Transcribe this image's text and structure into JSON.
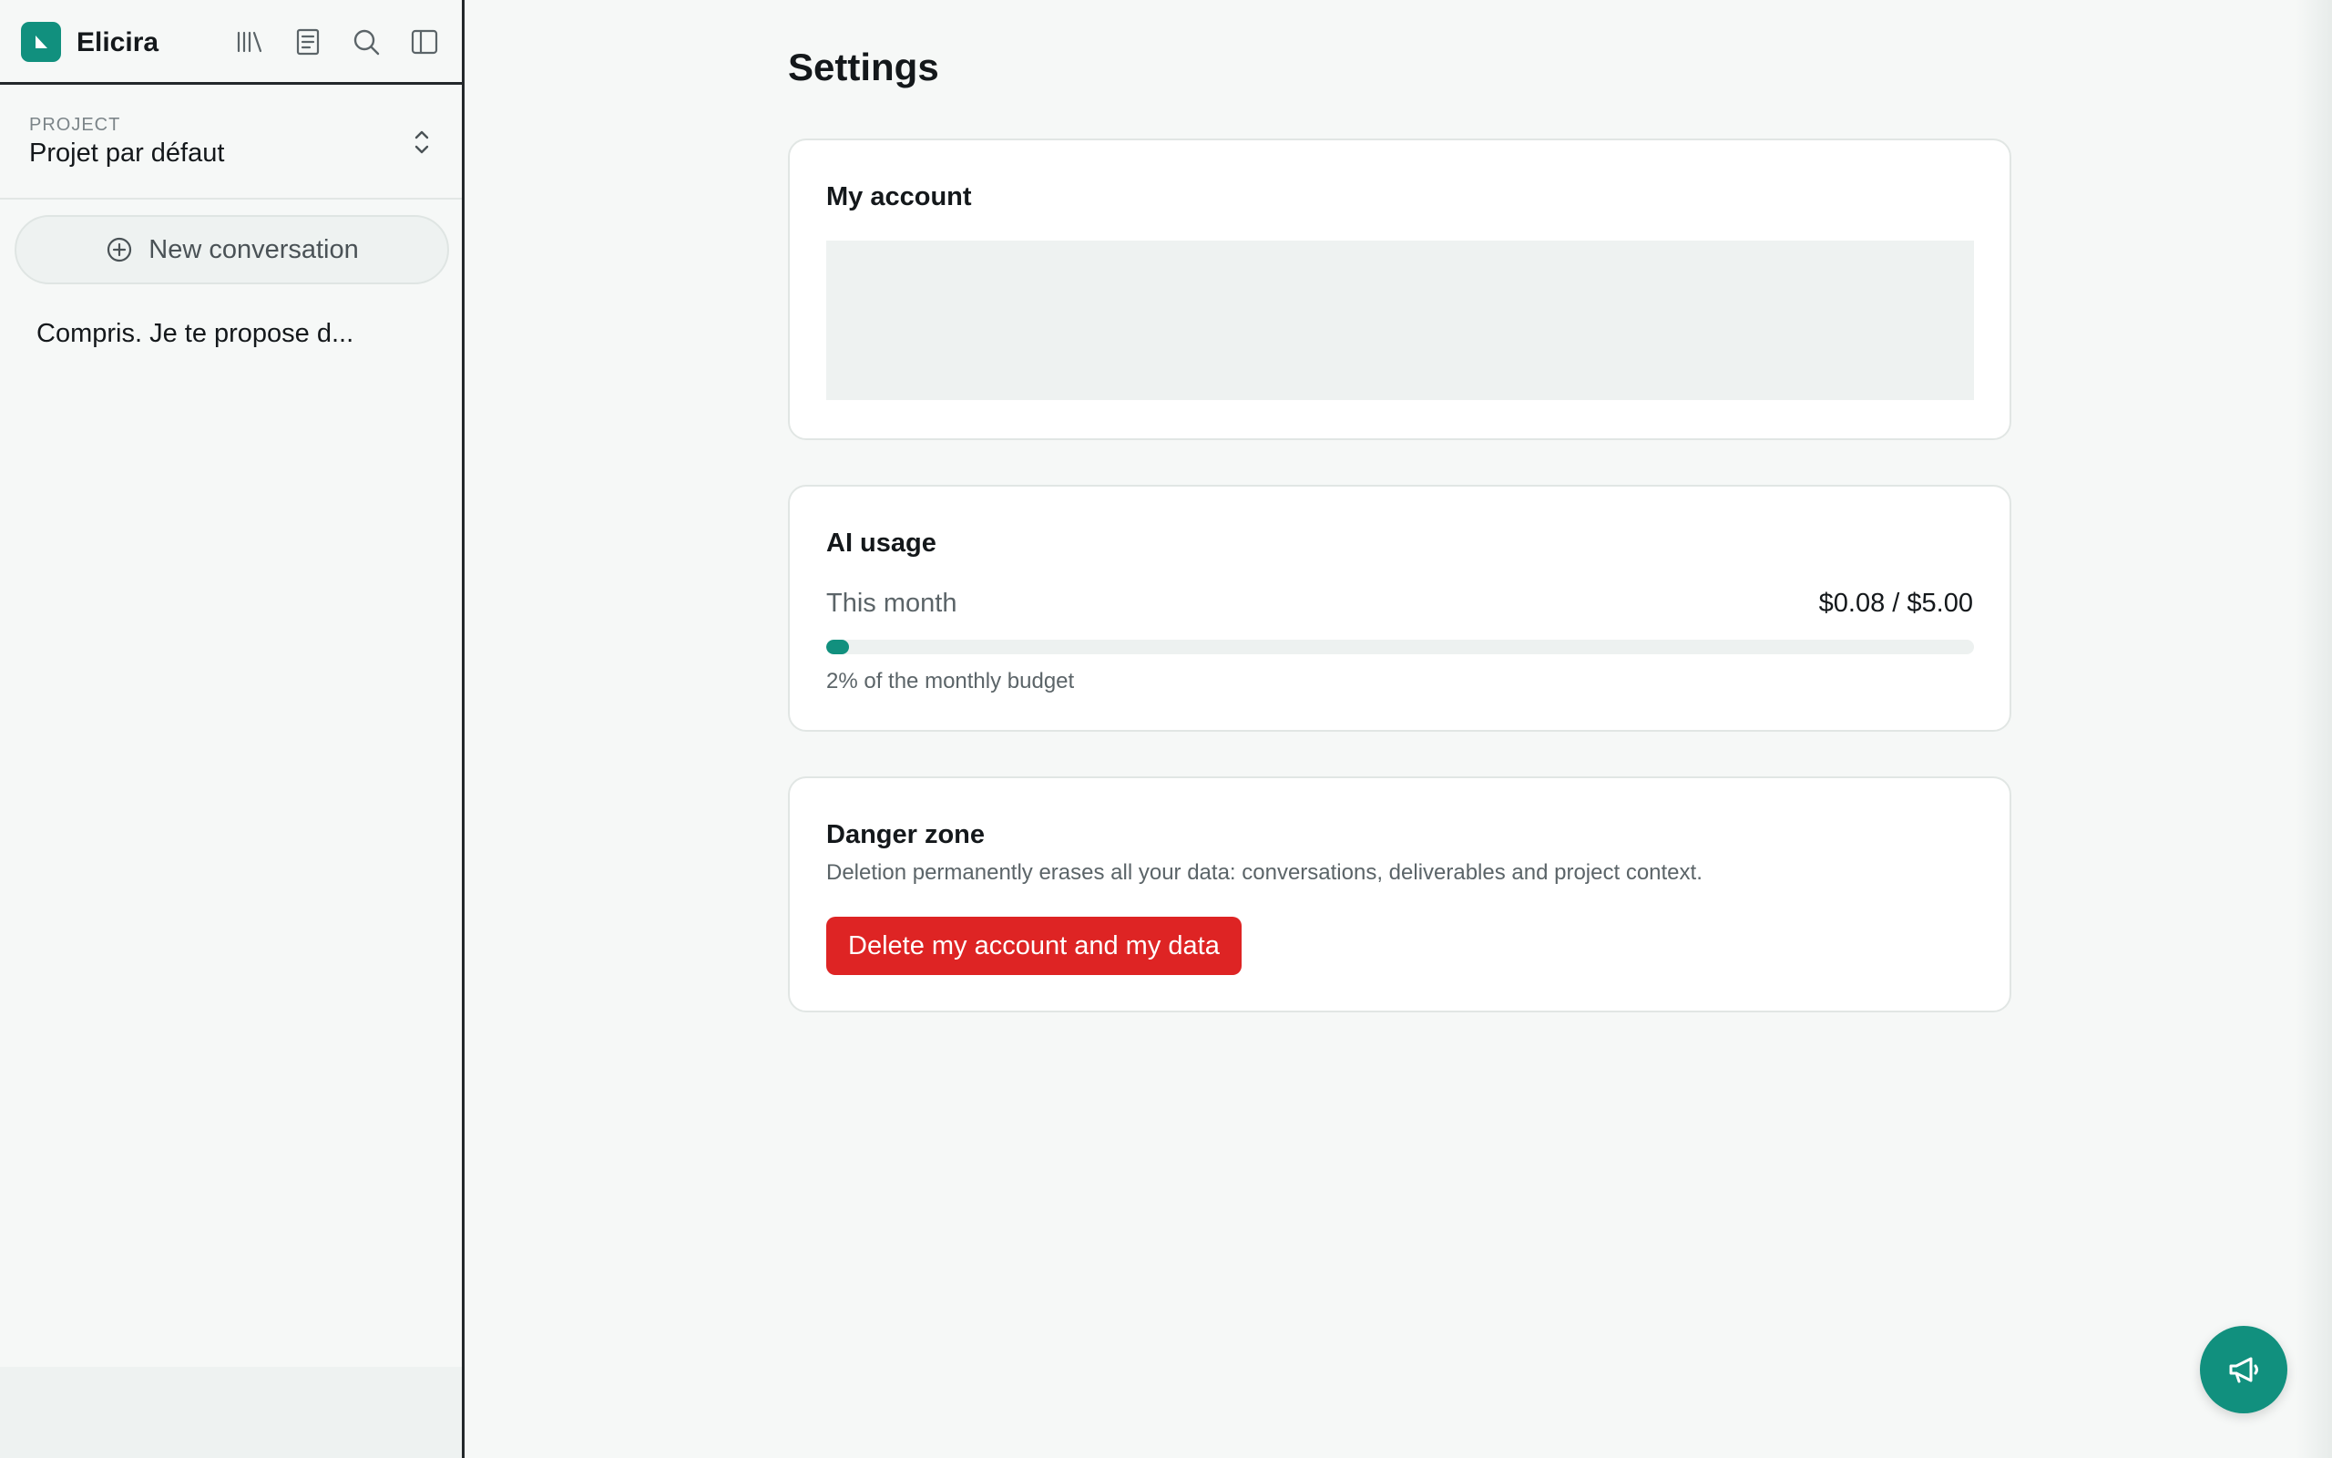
{
  "app": {
    "brand": "Elicira"
  },
  "header_icons": [
    "library-icon",
    "notebook-icon",
    "search-icon",
    "sidebar-toggle-icon"
  ],
  "project": {
    "label": "PROJECT",
    "name": "Projet par défaut"
  },
  "new_conversation": {
    "label": "New conversation"
  },
  "conversations": [
    {
      "title": "Compris. Je te propose d..."
    }
  ],
  "settings": {
    "title": "Settings",
    "account": {
      "title": "My account"
    },
    "usage": {
      "title": "AI usage",
      "period_label": "This month",
      "value": "$0.08 / $5.00",
      "progress_fraction": 0.02,
      "note": "2% of the monthly budget"
    },
    "danger": {
      "title": "Danger zone",
      "description": "Deletion permanently erases all your data: conversations, deliverables and project context.",
      "button_label": "Delete my account and my data"
    }
  },
  "colors": {
    "accent": "#11907e",
    "danger": "#de2424",
    "background": "#f6f8f7"
  }
}
